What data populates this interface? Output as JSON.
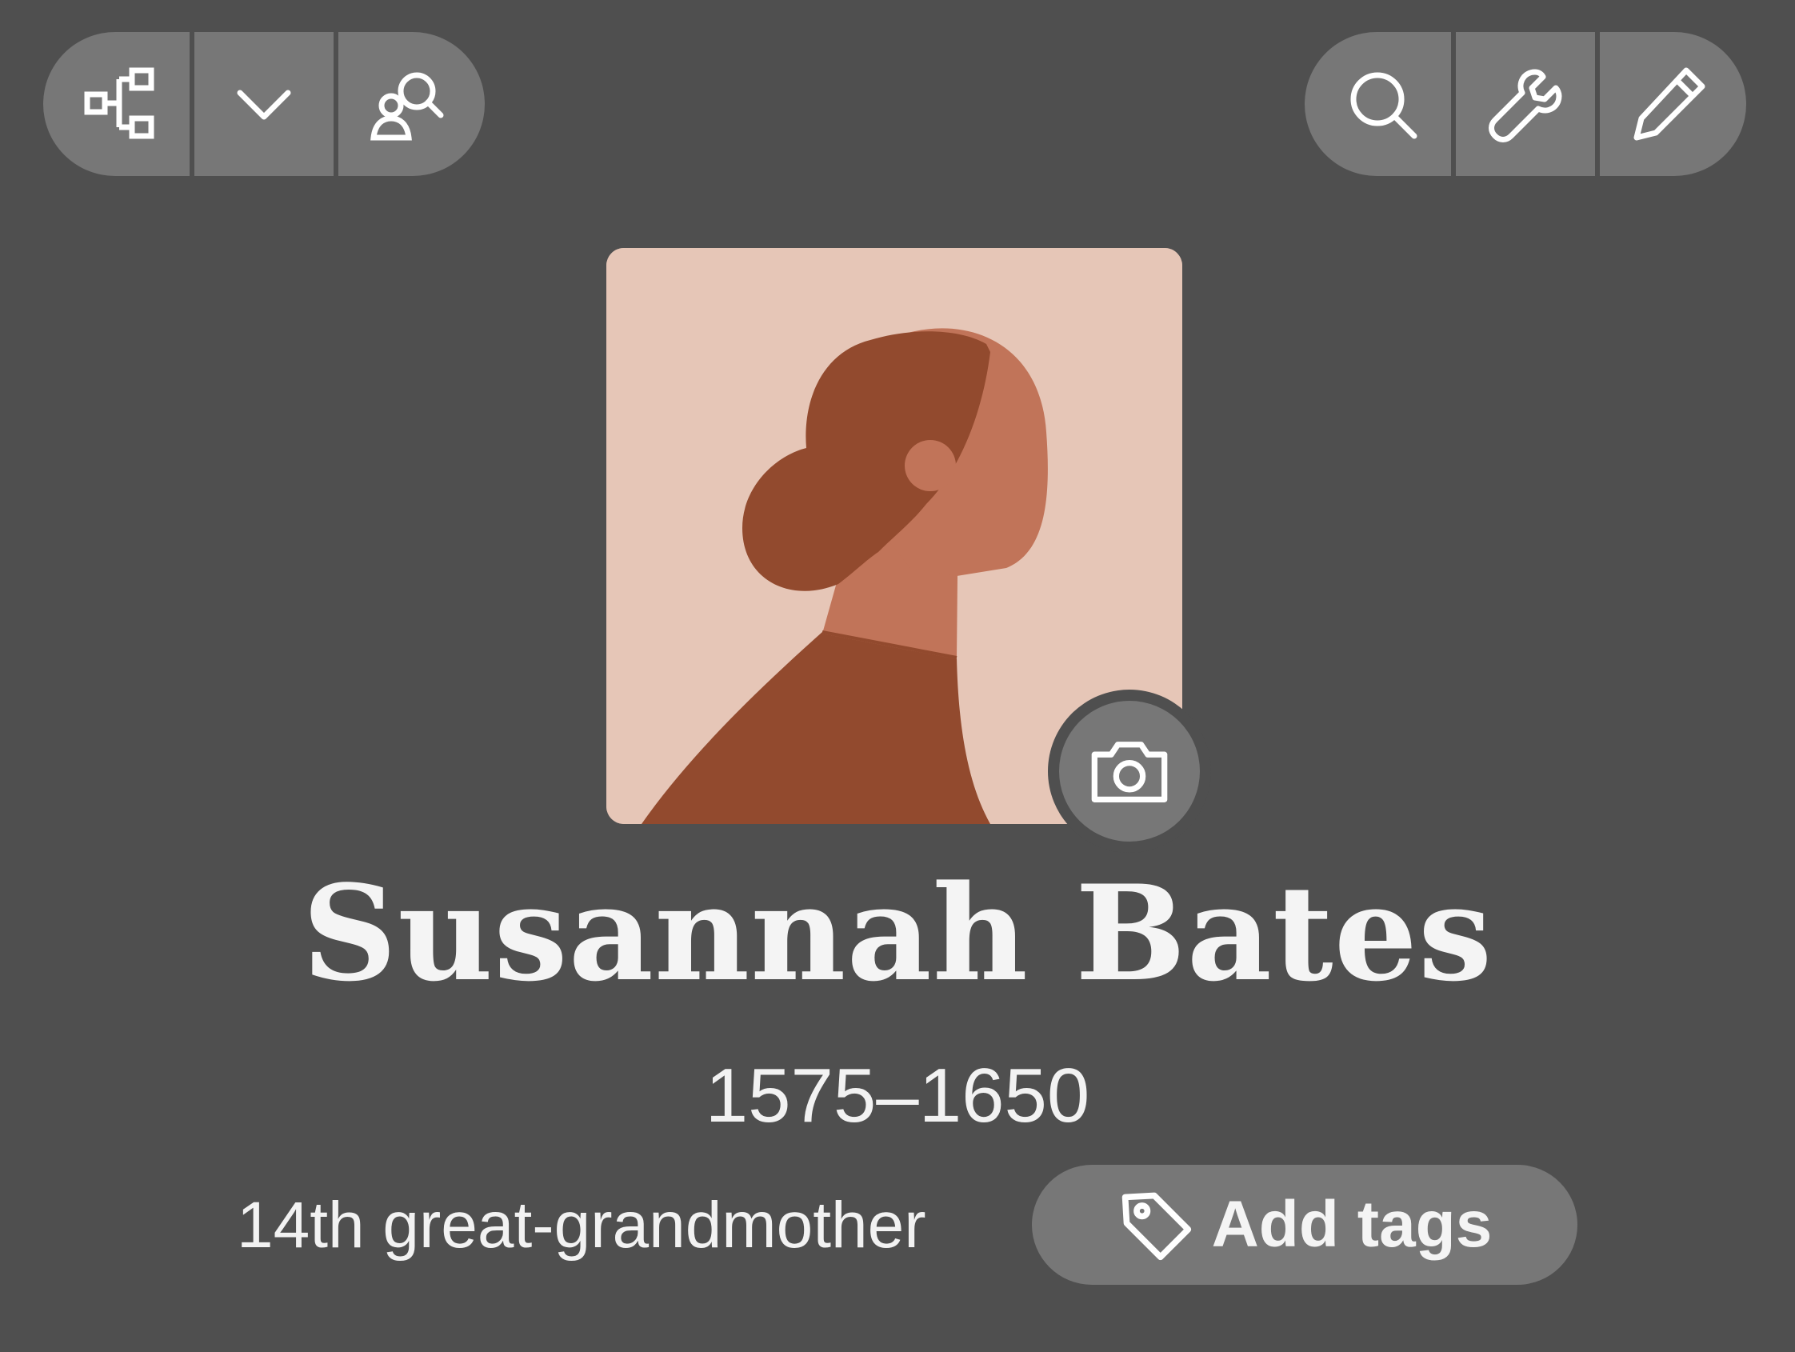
{
  "toolbar": {
    "left": [
      {
        "icon": "family-tree-icon"
      },
      {
        "icon": "chevron-down-icon"
      },
      {
        "icon": "person-search-icon"
      }
    ],
    "right": [
      {
        "icon": "search-icon"
      },
      {
        "icon": "wrench-icon"
      },
      {
        "icon": "pencil-icon"
      }
    ]
  },
  "profile": {
    "photo_icon": "camera-icon",
    "name": "Susannah Bates",
    "lifespan": "1575–1650",
    "relationship": "14th great-grandmother",
    "add_tags_label": "Add tags",
    "add_tags_icon": "tag-icon"
  },
  "colors": {
    "background": "#4f4f4f",
    "button": "#777777",
    "portrait_bg": "#e6c6b7",
    "hair": "#924a2e",
    "skin": "#c17459"
  }
}
